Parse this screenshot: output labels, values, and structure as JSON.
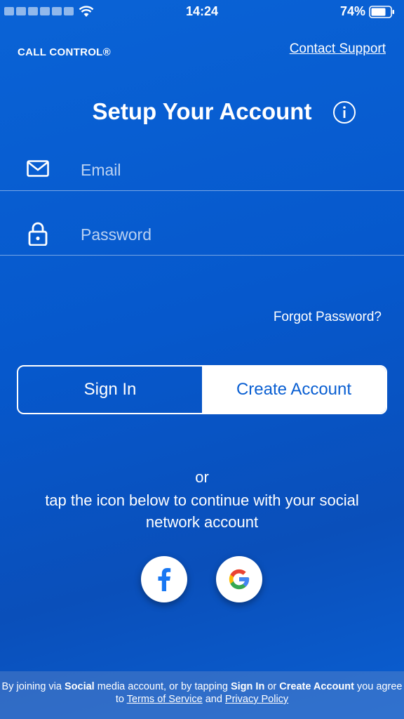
{
  "status_bar": {
    "time": "14:24",
    "battery": "74%"
  },
  "header": {
    "brand": "CALL CONTROL®",
    "contact_link": "Contact Support"
  },
  "title": "Setup Your Account",
  "form": {
    "email_placeholder": "Email",
    "password_placeholder": "Password",
    "forgot_password": "Forgot Password?"
  },
  "auth_toggle": {
    "sign_in": "Sign In",
    "create_account": "Create Account",
    "selected": "Create Account"
  },
  "social": {
    "or": "or",
    "prompt": "tap the icon below to continue with your social network account",
    "facebook_glyph": "f"
  },
  "footer": {
    "part1": "By joining via ",
    "bold1": "Social",
    "part2": " media account, or by tapping ",
    "bold2": "Sign In",
    "part3": " or ",
    "bold3": "Create Account",
    "part4": " you agree to ",
    "terms_link": "Terms of Service",
    "part5": " and ",
    "privacy_link": "Privacy Policy"
  },
  "colors": {
    "background": "#0a5fd2",
    "accent": "#ffffff",
    "google_blue": "#4285F4",
    "google_red": "#EA4335",
    "google_yellow": "#FBBC05",
    "google_green": "#34A853",
    "facebook_blue": "#1877F2"
  }
}
